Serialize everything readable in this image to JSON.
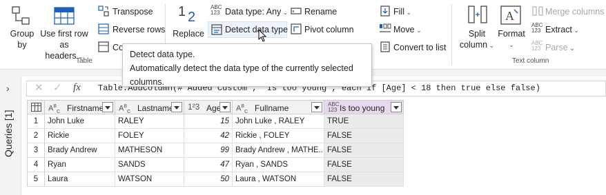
{
  "ribbon": {
    "group_by": {
      "line1": "Group",
      "line2": "by"
    },
    "use_first_row": {
      "line1": "Use first row as",
      "line2": "headers"
    },
    "transpose": "Transpose",
    "reverse_rows": "Reverse rows",
    "count_rows": "Co",
    "table_group": "Table",
    "replace": "Replace",
    "data_type": "Data type: Any",
    "detect_data_type": "Detect data type",
    "rename": "Rename",
    "pivot_column": "Pivot column",
    "fill": "Fill",
    "move": "Move",
    "convert_to_list": "Convert to list",
    "split_column": {
      "line1": "Split",
      "line2": "column"
    },
    "format": "Format",
    "merge_columns": "Merge columns",
    "extract": "Extract",
    "parse": "Parse",
    "text_column_group": "Text column",
    "abc_icon_top": "ABC",
    "abc_icon_bottom": "123"
  },
  "tooltip": {
    "title": "Detect data type.",
    "description": "Automatically detect the data type of the currently selected columns."
  },
  "sidebar": {
    "queries_label": "Queries [1]",
    "expand_icon": "chevron-right-icon"
  },
  "formula": {
    "fx": "fx",
    "text": "Table.AddColumn(#\"Added Custom\", \"Is too young\", each if [Age] < 18 then true else false)"
  },
  "table": {
    "columns": [
      {
        "name": "Firstname",
        "type_icon": "ABC"
      },
      {
        "name": "Lastname",
        "type_icon": "ABC"
      },
      {
        "name": "Age",
        "type_icon": "123"
      },
      {
        "name": "Fullname",
        "type_icon": "ABC"
      },
      {
        "name": "Is too young",
        "type_icon": "ABC/123"
      }
    ],
    "rows": [
      {
        "n": "1",
        "first": "John Luke",
        "last": "RALEY",
        "age": "15",
        "full": "John Luke , RALEY",
        "young": "TRUE"
      },
      {
        "n": "2",
        "first": "Rickie",
        "last": "FOLEY",
        "age": "42",
        "full": "Rickie , FOLEY",
        "young": "FALSE"
      },
      {
        "n": "3",
        "first": "Brady Andrew",
        "last": "MATHESON",
        "age": "99",
        "full": "Brady Andrew , MATHE...",
        "young": "FALSE"
      },
      {
        "n": "4",
        "first": "Ryan",
        "last": "SANDS",
        "age": "47",
        "full": "Ryan , SANDS",
        "young": "FALSE"
      },
      {
        "n": "5",
        "first": "Laura",
        "last": "WATSON",
        "age": "50",
        "full": "Laura , WATSON",
        "young": "FALSE"
      }
    ]
  },
  "colors": {
    "accent": "#1f5fbf",
    "selected_col": "#e7d8f0"
  }
}
